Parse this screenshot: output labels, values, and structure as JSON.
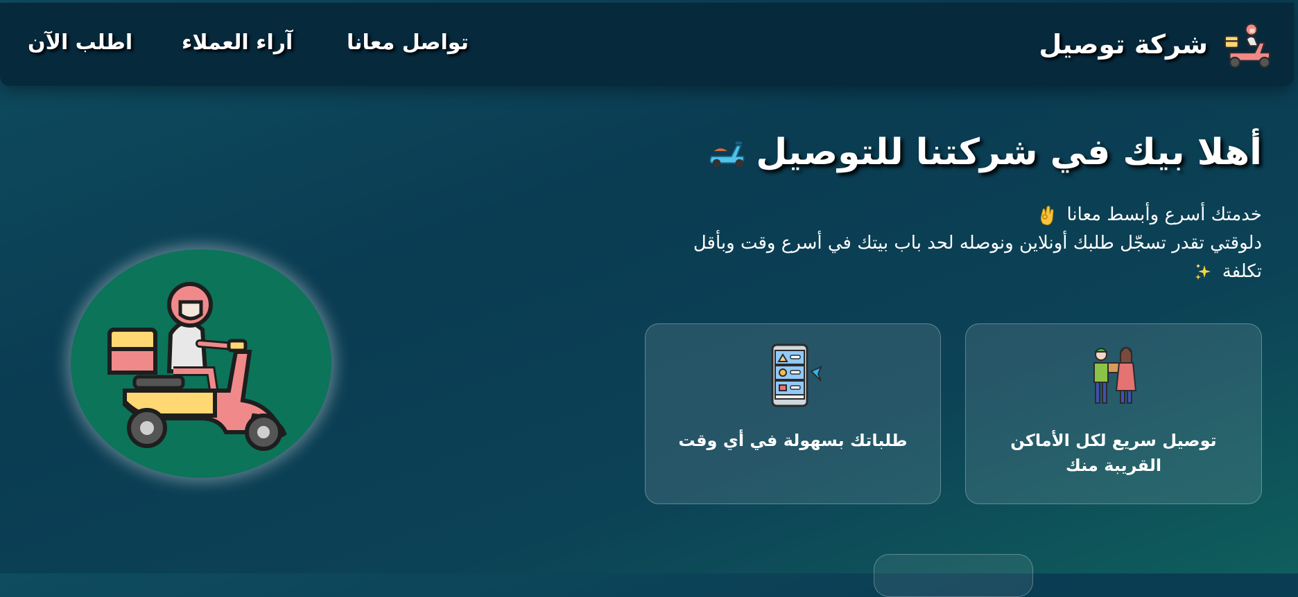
{
  "navbar": {
    "brand_name": "شركة توصيل",
    "brand_logo_icon": "delivery-scooter-icon",
    "links": {
      "contact": "تواصل معانا",
      "reviews": "آراء العملاء",
      "order": "اطلب الآن"
    }
  },
  "hero": {
    "title": "أهلا بيك في شركتنا للتوصيل",
    "title_icon": "scooter-emoji-icon",
    "desc_line1": "خدمتك أسرع وأبسط معانا",
    "desc_line1_icon": "ok-hand-emoji-icon",
    "desc_line2": "دلوقتي تقدر تسجّل طلبك أونلاين ونوصله لحد باب بيتك في أسرع وقت وبأقل",
    "desc_line3": "تكلفة",
    "desc_line3_icon": "sparkles-emoji-icon"
  },
  "cards": [
    {
      "label": "توصيل سريع لكل الأماكن القريبة منك",
      "icon": "package-handover-icon"
    },
    {
      "label": "طلباتك بسهولة في أي وقت",
      "icon": "mobile-order-icon"
    }
  ],
  "illustration": {
    "icon": "delivery-rider-icon"
  },
  "colors": {
    "background": "#0a3c52",
    "navbar": "#06293c",
    "circle": "#0b7459",
    "scooter_red": "#f08a8a",
    "scooter_yellow": "#ffd873"
  }
}
